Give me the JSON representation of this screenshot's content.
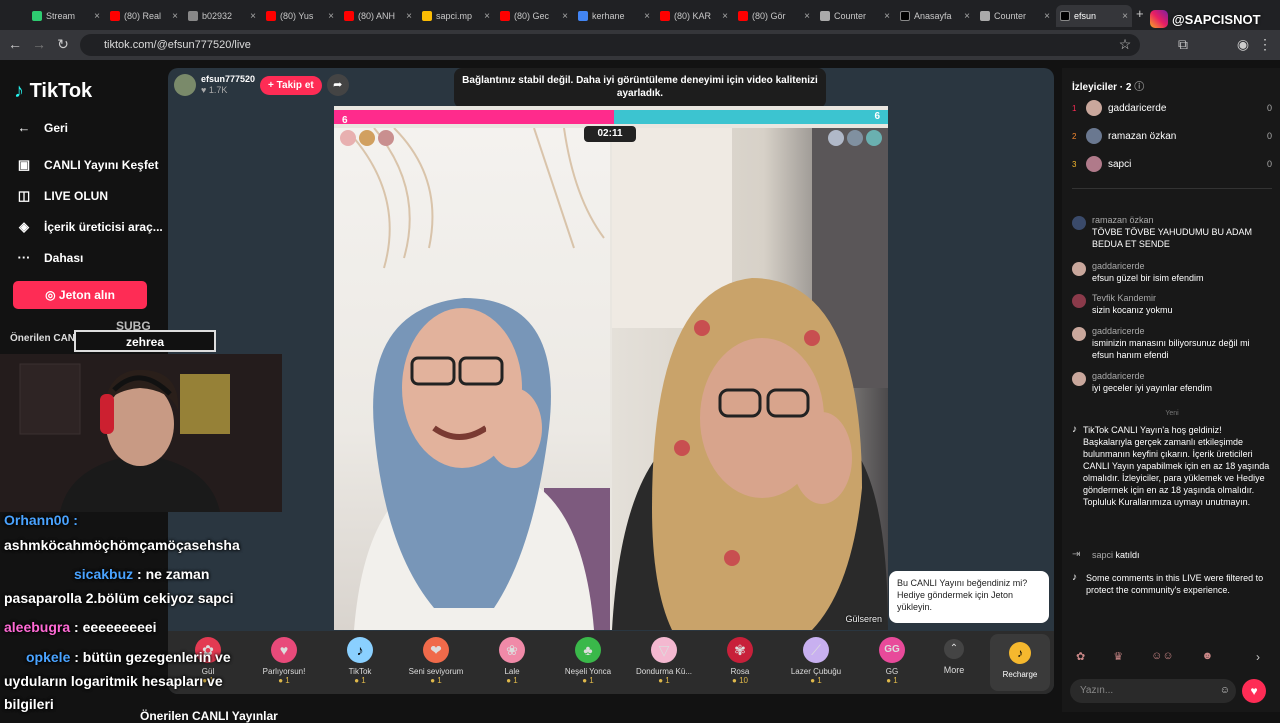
{
  "browser": {
    "tabs": [
      "Stream",
      "(80) Real",
      "b02932",
      "(80) Yus",
      "(80) ANH",
      "sapci.mp",
      "(80) Gec",
      "kerhane",
      "(80) KAR",
      "(80) Gör",
      "Counter",
      "Anasayfa",
      "Counter",
      "efsun"
    ],
    "url": "tiktok.com/@efsun777520/live",
    "watermark": "@SAPCISNOT"
  },
  "sidenav": {
    "logo": "TikTok",
    "items": [
      "Geri",
      "CANLI Yayını Keşfet",
      "LIVE OLUN",
      "İçerik üreticisi araç...",
      "Dahası"
    ],
    "jeton": "Jeton alın",
    "suggested": "Önerilen CANLI Yayın içerik"
  },
  "host": {
    "name": "efsun777520",
    "likes": "1.7K",
    "follow": "+ Takip et"
  },
  "toast": "Bağlantınız stabil değil. Daha iyi görüntüleme deneyimi için video kalitenizi ayarladık.",
  "battle": {
    "left_score": "6",
    "right_score": "6",
    "timer": "02:11",
    "right_name": "Gülseren"
  },
  "gifts": [
    {
      "name": "Gül",
      "cost": "1"
    },
    {
      "name": "Parlıyorsun!",
      "cost": "1"
    },
    {
      "name": "TikTok",
      "cost": "1"
    },
    {
      "name": "Seni seviyorum",
      "cost": "1"
    },
    {
      "name": "Lale",
      "cost": "1"
    },
    {
      "name": "Neşeli Yonca",
      "cost": "1"
    },
    {
      "name": "Dondurma Kü...",
      "cost": "1"
    },
    {
      "name": "Rosa",
      "cost": "10"
    },
    {
      "name": "Lazer Çubuğu",
      "cost": "1"
    },
    {
      "name": "GG",
      "cost": "1"
    }
  ],
  "more": "More",
  "recharge": "Recharge",
  "tooltip": "Bu CANLI Yayını beğendiniz mi? Hediye göndermek için Jeton yükleyin.",
  "viewers": {
    "title": "İzleyiciler · 2",
    "list": [
      {
        "rank": "1",
        "name": "gaddaricerde",
        "score": "0"
      },
      {
        "rank": "2",
        "name": "ramazan özkan",
        "score": "0"
      },
      {
        "rank": "3",
        "name": "sapci",
        "score": "0"
      }
    ]
  },
  "comments": [
    {
      "name": "ramazan özkan",
      "text": "TÖVBE TÖVBE YAHUDUMU BU ADAM BEDUA ET SENDE"
    },
    {
      "name": "gaddaricerde",
      "text": "efsun güzel bir isim efendim"
    },
    {
      "name": "Tevfik Kandemir",
      "text": "sizin kocanız yokmu"
    },
    {
      "name": "gaddaricerde",
      "text": "isminizin manasını biliyorsunuz değil mi efsun hanım efendi"
    },
    {
      "name": "gaddaricerde",
      "text": "iyi geceler iyi yayınlar efendim"
    }
  ],
  "new_label": "Yeni",
  "welcome": "TikTok CANLI Yayın'a hoş geldiniz! Başkalarıyla gerçek zamanlı etkileşimde bulunmanın keyfini çıkarın. İçerik üreticileri CANLI Yayın yapabilmek için en az 18 yaşında olmalıdır. İzleyiciler, para yüklemek ve Hediye göndermek için en az 18 yaşında olmalıdır. Topluluk Kurallarımıza uymayı unutmayın.",
  "joined": {
    "name": "sapci",
    "text": "katıldı"
  },
  "filtered": "Some comments in this LIVE were filtered to protect the community's experience.",
  "input_placeholder": "Yazın...",
  "overlay": {
    "sub_badge": "SUBG",
    "sub_name": "zehrea",
    "lines": [
      {
        "name": "Orhann00 :",
        "text": ""
      },
      {
        "name": "",
        "text": "ashmköcahmöçhömçamöçasehsha"
      },
      {
        "name": "sicakbuz",
        "text": " : ne zaman"
      },
      {
        "name": "",
        "text": "pasaparolla 2.bölüm cekiyoz sapci"
      },
      {
        "name": "aleebugra",
        "text": " : eeeeeeeeei"
      },
      {
        "name": "opkele",
        "text": " : bütün gezegenlerin ve"
      },
      {
        "name": "",
        "text": "uyduların logaritmik hesapları ve"
      },
      {
        "name": "",
        "text": "bilgileri"
      }
    ],
    "bottom": "Önerilen CANLI Yayınlar"
  }
}
